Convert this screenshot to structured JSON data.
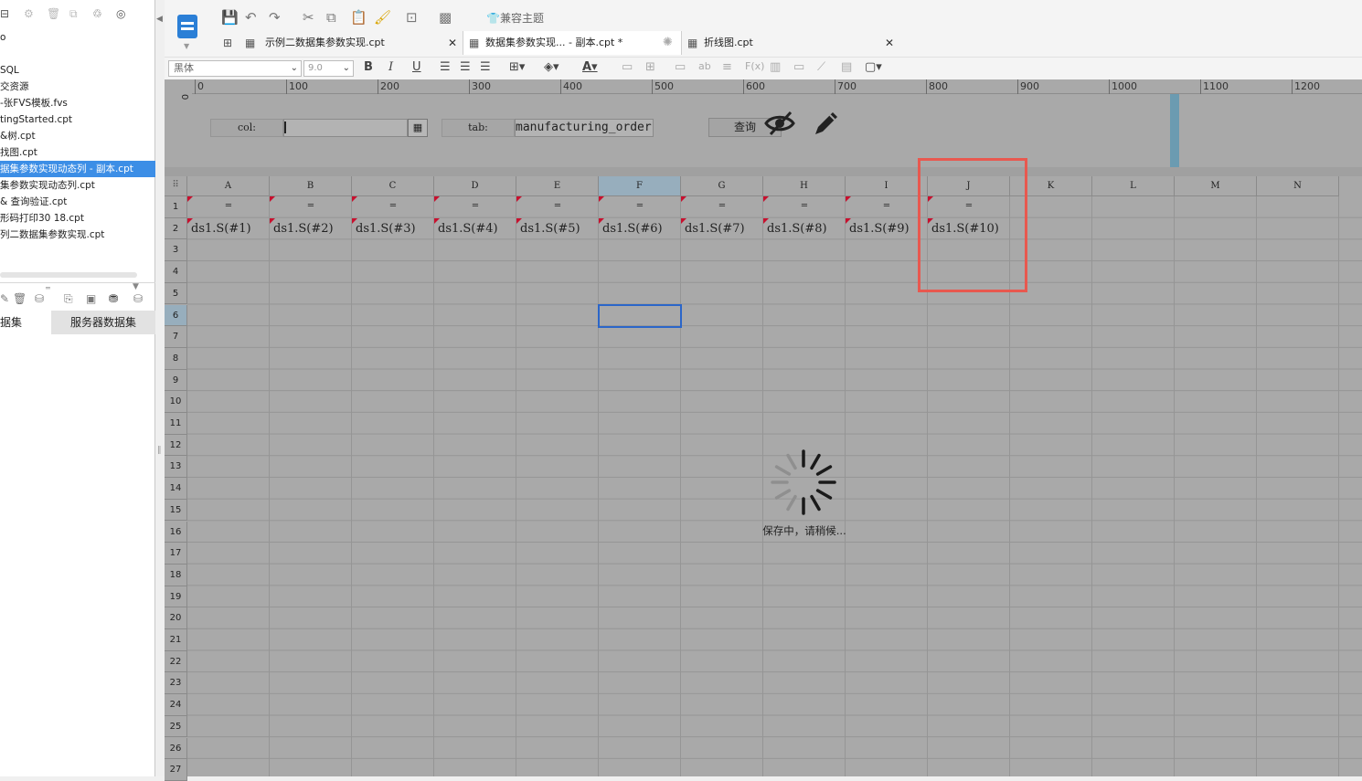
{
  "left_panel": {
    "files": [
      {
        "name": "o",
        "selected": false
      },
      {
        "name": "",
        "selected": false
      },
      {
        "name": "SQL",
        "selected": false
      },
      {
        "name": "交资源",
        "selected": false
      },
      {
        "name": "-张FVS模板.fvs",
        "selected": false
      },
      {
        "name": "tingStarted.cpt",
        "selected": false
      },
      {
        "name": "&树.cpt",
        "selected": false
      },
      {
        "name": "找图.cpt",
        "selected": false
      },
      {
        "name": "据集参数实现动态列 - 副本.cpt",
        "selected": true
      },
      {
        "name": "集参数实现动态列.cpt",
        "selected": false
      },
      {
        "name": "&  查询验证.cpt",
        "selected": false
      },
      {
        "name": "形码打印30 18.cpt",
        "selected": false
      },
      {
        "name": "列二数据集参数实现.cpt",
        "selected": false
      }
    ],
    "dataset_tabs": [
      "据集",
      "服务器数据集"
    ]
  },
  "toolbar": {
    "compat_label": "兼容主题"
  },
  "tabs": [
    {
      "label": "示例二数据集参数实现.cpt",
      "active": false
    },
    {
      "label": "数据集参数实现... - 副本.cpt *",
      "active": true
    },
    {
      "label": "折线图.cpt",
      "active": false
    }
  ],
  "format": {
    "font": "黑体",
    "size": "9.0"
  },
  "ruler": {
    "ticks": [
      "0",
      "100",
      "200",
      "300",
      "400",
      "500",
      "600",
      "700",
      "800",
      "900",
      "1000",
      "1100",
      "1200"
    ],
    "vertical_label": "0"
  },
  "params": {
    "col_label": "col:",
    "col_value": "",
    "tab_label": "tab:",
    "tab_value": "manufacturing_order",
    "query_label": "查询"
  },
  "grid": {
    "columns": [
      "A",
      "B",
      "C",
      "D",
      "E",
      "F",
      "G",
      "H",
      "I",
      "J",
      "K",
      "L",
      "M",
      "N"
    ],
    "rows": [
      "1",
      "2",
      "3",
      "4",
      "5",
      "6",
      "7",
      "8",
      "9",
      "10",
      "11",
      "12",
      "13",
      "14",
      "15",
      "16",
      "17",
      "18",
      "19",
      "20",
      "21",
      "22",
      "23",
      "24",
      "25",
      "26",
      "27"
    ],
    "row1": [
      "=",
      "=",
      "=",
      "=",
      "=",
      "=",
      "=",
      "=",
      "=",
      "="
    ],
    "row2": [
      "ds1.S(#1)",
      "ds1.S(#2)",
      "ds1.S(#3)",
      "ds1.S(#4)",
      "ds1.S(#5)",
      "ds1.S(#6)",
      "ds1.S(#7)",
      "ds1.S(#8)",
      "ds1.S(#9)",
      "ds1.S(#10)"
    ],
    "selected_cell": "F6",
    "highlighted_column": "J"
  },
  "status": {
    "saving_text": "保存中，请稍候..."
  },
  "colors": {
    "accent": "#3c8ee6",
    "highlight_box": "#e8584f",
    "cell_flag": "#c8102e",
    "selection": "#2b66c9"
  }
}
